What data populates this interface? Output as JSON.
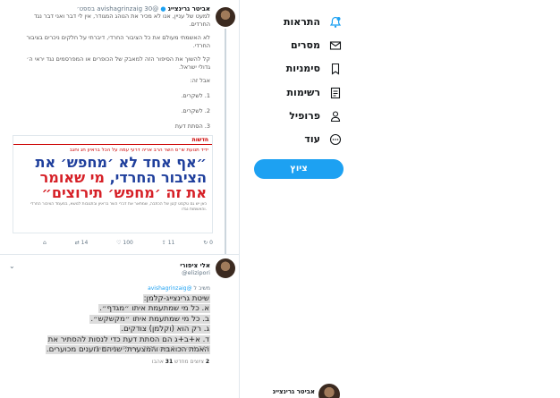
{
  "sidebar": {
    "items": [
      {
        "label": "התראות",
        "icon": "notifications-icon"
      },
      {
        "label": "מסרים",
        "icon": "messages-icon"
      },
      {
        "label": "סימניות",
        "icon": "bookmarks-icon"
      },
      {
        "label": "רשימות",
        "icon": "lists-icon"
      },
      {
        "label": "פרופיל",
        "icon": "profile-icon"
      },
      {
        "label": "עוד",
        "icon": "more-icon"
      }
    ],
    "tweet_button": "ציוץ",
    "accent_color": "#1da1f2"
  },
  "tweet1": {
    "name": "אביטר גרינצייג",
    "handle": "@avishagrinzaig",
    "time": "30 בספט׳",
    "text": [
      "למעט של עניין, אנו לא מכיר את הנוהג המגודר, אין לי דבר ואני דבר נגד",
      "החרדים.",
      "לא האשמתי מעולם את כל הציבור החרדי, דיברתי על חלקים ניכרים בציבור",
      "החרדי.",
      "קל להשוך את הסיפור הזה למאבק של הכופרים או המפרסמים נגד יראי ה׳",
      "גדולי ישראל.",
      "אבל זה:",
      "1. לשקרים.",
      "2. לשקרים.",
      "3. הסתת דעת"
    ],
    "news": {
      "top": "חדשות",
      "sub": "ידיד תנועת ש״ס השר הרב אריה דרעי עמה על הכל בראיון חג וחגב",
      "headline_1": "״אף אחד לא ׳מחפש׳ את",
      "headline_2a": "הציבור החרדי,",
      "headline_2b": " מי שאומר",
      "headline_3": "את זה ׳מחפש׳ תירוצים״",
      "body": "כאן יש גם טקסט קטן של הכתבה, שמתאר את דברי השר בראיון ובתגובות לנושא, במעמד הציבור החרדי והאשמות נגדו."
    },
    "actions": [
      "⌂",
      "⇄ 14",
      "♡ 100",
      "⇪ 11",
      "↻ 0"
    ]
  },
  "tweet2": {
    "name": "אלי ציפורי",
    "handle": "@elizipori",
    "reply_prefix": "משיב ל",
    "reply_to": "@avishagrinzaig",
    "lines": [
      "שיטת גרינצייג-קלמן:",
      "א. כל מי שמתעמת איתו ״מגדף״.",
      "ב. כל מי שמתעמת איתו ״מקשקש״.",
      "ג. רק הוא (וקלמן) צודקים.",
      "ד. א+ב+ג הם הסתת דעת כדי לנסות להסתיר את",
      "האמת הכואבת והמצערת: שניהם גזענים מכוערים."
    ],
    "meta": "7:19 לפנה״צ · 1 באוק׳ 2020 · Twitter for iPhone",
    "stats": "2 ציוצים מחדש 31 אהבו",
    "retweets": "2",
    "likes": "31"
  },
  "tweet3": {
    "name": "אביטר גרינצייג"
  }
}
